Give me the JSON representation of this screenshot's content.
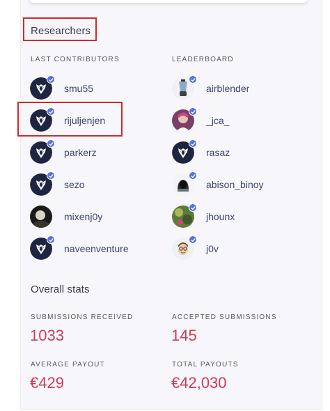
{
  "researchers": {
    "title": "Researchers",
    "last_contributors_label": "LAST CONTRIBUTORS",
    "leaderboard_label": "LEADERBOARD",
    "last_contributors": [
      {
        "name": "smu55",
        "avatar": "bee-logo-avatar",
        "verified": true
      },
      {
        "name": "rijuljenjen",
        "avatar": "bee-logo-avatar",
        "verified": true
      },
      {
        "name": "parkerz",
        "avatar": "bee-logo-avatar",
        "verified": true
      },
      {
        "name": "sezo",
        "avatar": "bee-logo-avatar",
        "verified": true
      },
      {
        "name": "mixenj0y",
        "avatar": "photo-avatar",
        "verified": false
      },
      {
        "name": "naveenventure",
        "avatar": "bee-logo-avatar",
        "verified": true
      }
    ],
    "leaderboard": [
      {
        "name": "airblender",
        "avatar": "blender-avatar",
        "verified": true
      },
      {
        "name": "_jca_",
        "avatar": "character-avatar",
        "verified": true
      },
      {
        "name": "rasaz",
        "avatar": "bee-logo-avatar",
        "verified": true
      },
      {
        "name": "abison_binoy",
        "avatar": "hacker-avatar",
        "verified": true
      },
      {
        "name": "jhounx",
        "avatar": "nature-avatar",
        "verified": true
      },
      {
        "name": "j0v",
        "avatar": "cartoon-face-avatar",
        "verified": true
      }
    ]
  },
  "overall_stats": {
    "title": "Overall stats",
    "submissions_received_label": "SUBMISSIONS RECEIVED",
    "submissions_received": "1033",
    "accepted_submissions_label": "ACCEPTED SUBMISSIONS",
    "accepted_submissions": "145",
    "average_payout_label": "AVERAGE PAYOUT",
    "average_payout": "€429",
    "total_payouts_label": "TOTAL PAYOUTS",
    "total_payouts": "€42,030"
  },
  "colors": {
    "highlight_box": "#cc2b2b",
    "stat_value": "#d03a55",
    "username": "#3d4373",
    "verified_badge": "#5b6fd6",
    "avatar_dark": "#1d2540"
  }
}
